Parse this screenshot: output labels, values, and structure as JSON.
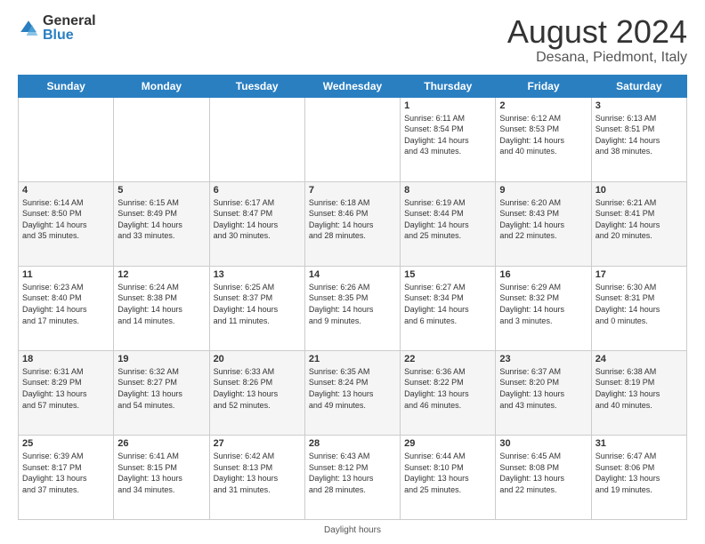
{
  "header": {
    "logo_general": "General",
    "logo_blue": "Blue",
    "month_title": "August 2024",
    "location": "Desana, Piedmont, Italy"
  },
  "weekdays": [
    "Sunday",
    "Monday",
    "Tuesday",
    "Wednesday",
    "Thursday",
    "Friday",
    "Saturday"
  ],
  "footer": {
    "note": "Daylight hours"
  },
  "weeks": [
    [
      {
        "day": "",
        "info": ""
      },
      {
        "day": "",
        "info": ""
      },
      {
        "day": "",
        "info": ""
      },
      {
        "day": "",
        "info": ""
      },
      {
        "day": "1",
        "info": "Sunrise: 6:11 AM\nSunset: 8:54 PM\nDaylight: 14 hours\nand 43 minutes."
      },
      {
        "day": "2",
        "info": "Sunrise: 6:12 AM\nSunset: 8:53 PM\nDaylight: 14 hours\nand 40 minutes."
      },
      {
        "day": "3",
        "info": "Sunrise: 6:13 AM\nSunset: 8:51 PM\nDaylight: 14 hours\nand 38 minutes."
      }
    ],
    [
      {
        "day": "4",
        "info": "Sunrise: 6:14 AM\nSunset: 8:50 PM\nDaylight: 14 hours\nand 35 minutes."
      },
      {
        "day": "5",
        "info": "Sunrise: 6:15 AM\nSunset: 8:49 PM\nDaylight: 14 hours\nand 33 minutes."
      },
      {
        "day": "6",
        "info": "Sunrise: 6:17 AM\nSunset: 8:47 PM\nDaylight: 14 hours\nand 30 minutes."
      },
      {
        "day": "7",
        "info": "Sunrise: 6:18 AM\nSunset: 8:46 PM\nDaylight: 14 hours\nand 28 minutes."
      },
      {
        "day": "8",
        "info": "Sunrise: 6:19 AM\nSunset: 8:44 PM\nDaylight: 14 hours\nand 25 minutes."
      },
      {
        "day": "9",
        "info": "Sunrise: 6:20 AM\nSunset: 8:43 PM\nDaylight: 14 hours\nand 22 minutes."
      },
      {
        "day": "10",
        "info": "Sunrise: 6:21 AM\nSunset: 8:41 PM\nDaylight: 14 hours\nand 20 minutes."
      }
    ],
    [
      {
        "day": "11",
        "info": "Sunrise: 6:23 AM\nSunset: 8:40 PM\nDaylight: 14 hours\nand 17 minutes."
      },
      {
        "day": "12",
        "info": "Sunrise: 6:24 AM\nSunset: 8:38 PM\nDaylight: 14 hours\nand 14 minutes."
      },
      {
        "day": "13",
        "info": "Sunrise: 6:25 AM\nSunset: 8:37 PM\nDaylight: 14 hours\nand 11 minutes."
      },
      {
        "day": "14",
        "info": "Sunrise: 6:26 AM\nSunset: 8:35 PM\nDaylight: 14 hours\nand 9 minutes."
      },
      {
        "day": "15",
        "info": "Sunrise: 6:27 AM\nSunset: 8:34 PM\nDaylight: 14 hours\nand 6 minutes."
      },
      {
        "day": "16",
        "info": "Sunrise: 6:29 AM\nSunset: 8:32 PM\nDaylight: 14 hours\nand 3 minutes."
      },
      {
        "day": "17",
        "info": "Sunrise: 6:30 AM\nSunset: 8:31 PM\nDaylight: 14 hours\nand 0 minutes."
      }
    ],
    [
      {
        "day": "18",
        "info": "Sunrise: 6:31 AM\nSunset: 8:29 PM\nDaylight: 13 hours\nand 57 minutes."
      },
      {
        "day": "19",
        "info": "Sunrise: 6:32 AM\nSunset: 8:27 PM\nDaylight: 13 hours\nand 54 minutes."
      },
      {
        "day": "20",
        "info": "Sunrise: 6:33 AM\nSunset: 8:26 PM\nDaylight: 13 hours\nand 52 minutes."
      },
      {
        "day": "21",
        "info": "Sunrise: 6:35 AM\nSunset: 8:24 PM\nDaylight: 13 hours\nand 49 minutes."
      },
      {
        "day": "22",
        "info": "Sunrise: 6:36 AM\nSunset: 8:22 PM\nDaylight: 13 hours\nand 46 minutes."
      },
      {
        "day": "23",
        "info": "Sunrise: 6:37 AM\nSunset: 8:20 PM\nDaylight: 13 hours\nand 43 minutes."
      },
      {
        "day": "24",
        "info": "Sunrise: 6:38 AM\nSunset: 8:19 PM\nDaylight: 13 hours\nand 40 minutes."
      }
    ],
    [
      {
        "day": "25",
        "info": "Sunrise: 6:39 AM\nSunset: 8:17 PM\nDaylight: 13 hours\nand 37 minutes."
      },
      {
        "day": "26",
        "info": "Sunrise: 6:41 AM\nSunset: 8:15 PM\nDaylight: 13 hours\nand 34 minutes."
      },
      {
        "day": "27",
        "info": "Sunrise: 6:42 AM\nSunset: 8:13 PM\nDaylight: 13 hours\nand 31 minutes."
      },
      {
        "day": "28",
        "info": "Sunrise: 6:43 AM\nSunset: 8:12 PM\nDaylight: 13 hours\nand 28 minutes."
      },
      {
        "day": "29",
        "info": "Sunrise: 6:44 AM\nSunset: 8:10 PM\nDaylight: 13 hours\nand 25 minutes."
      },
      {
        "day": "30",
        "info": "Sunrise: 6:45 AM\nSunset: 8:08 PM\nDaylight: 13 hours\nand 22 minutes."
      },
      {
        "day": "31",
        "info": "Sunrise: 6:47 AM\nSunset: 8:06 PM\nDaylight: 13 hours\nand 19 minutes."
      }
    ]
  ]
}
